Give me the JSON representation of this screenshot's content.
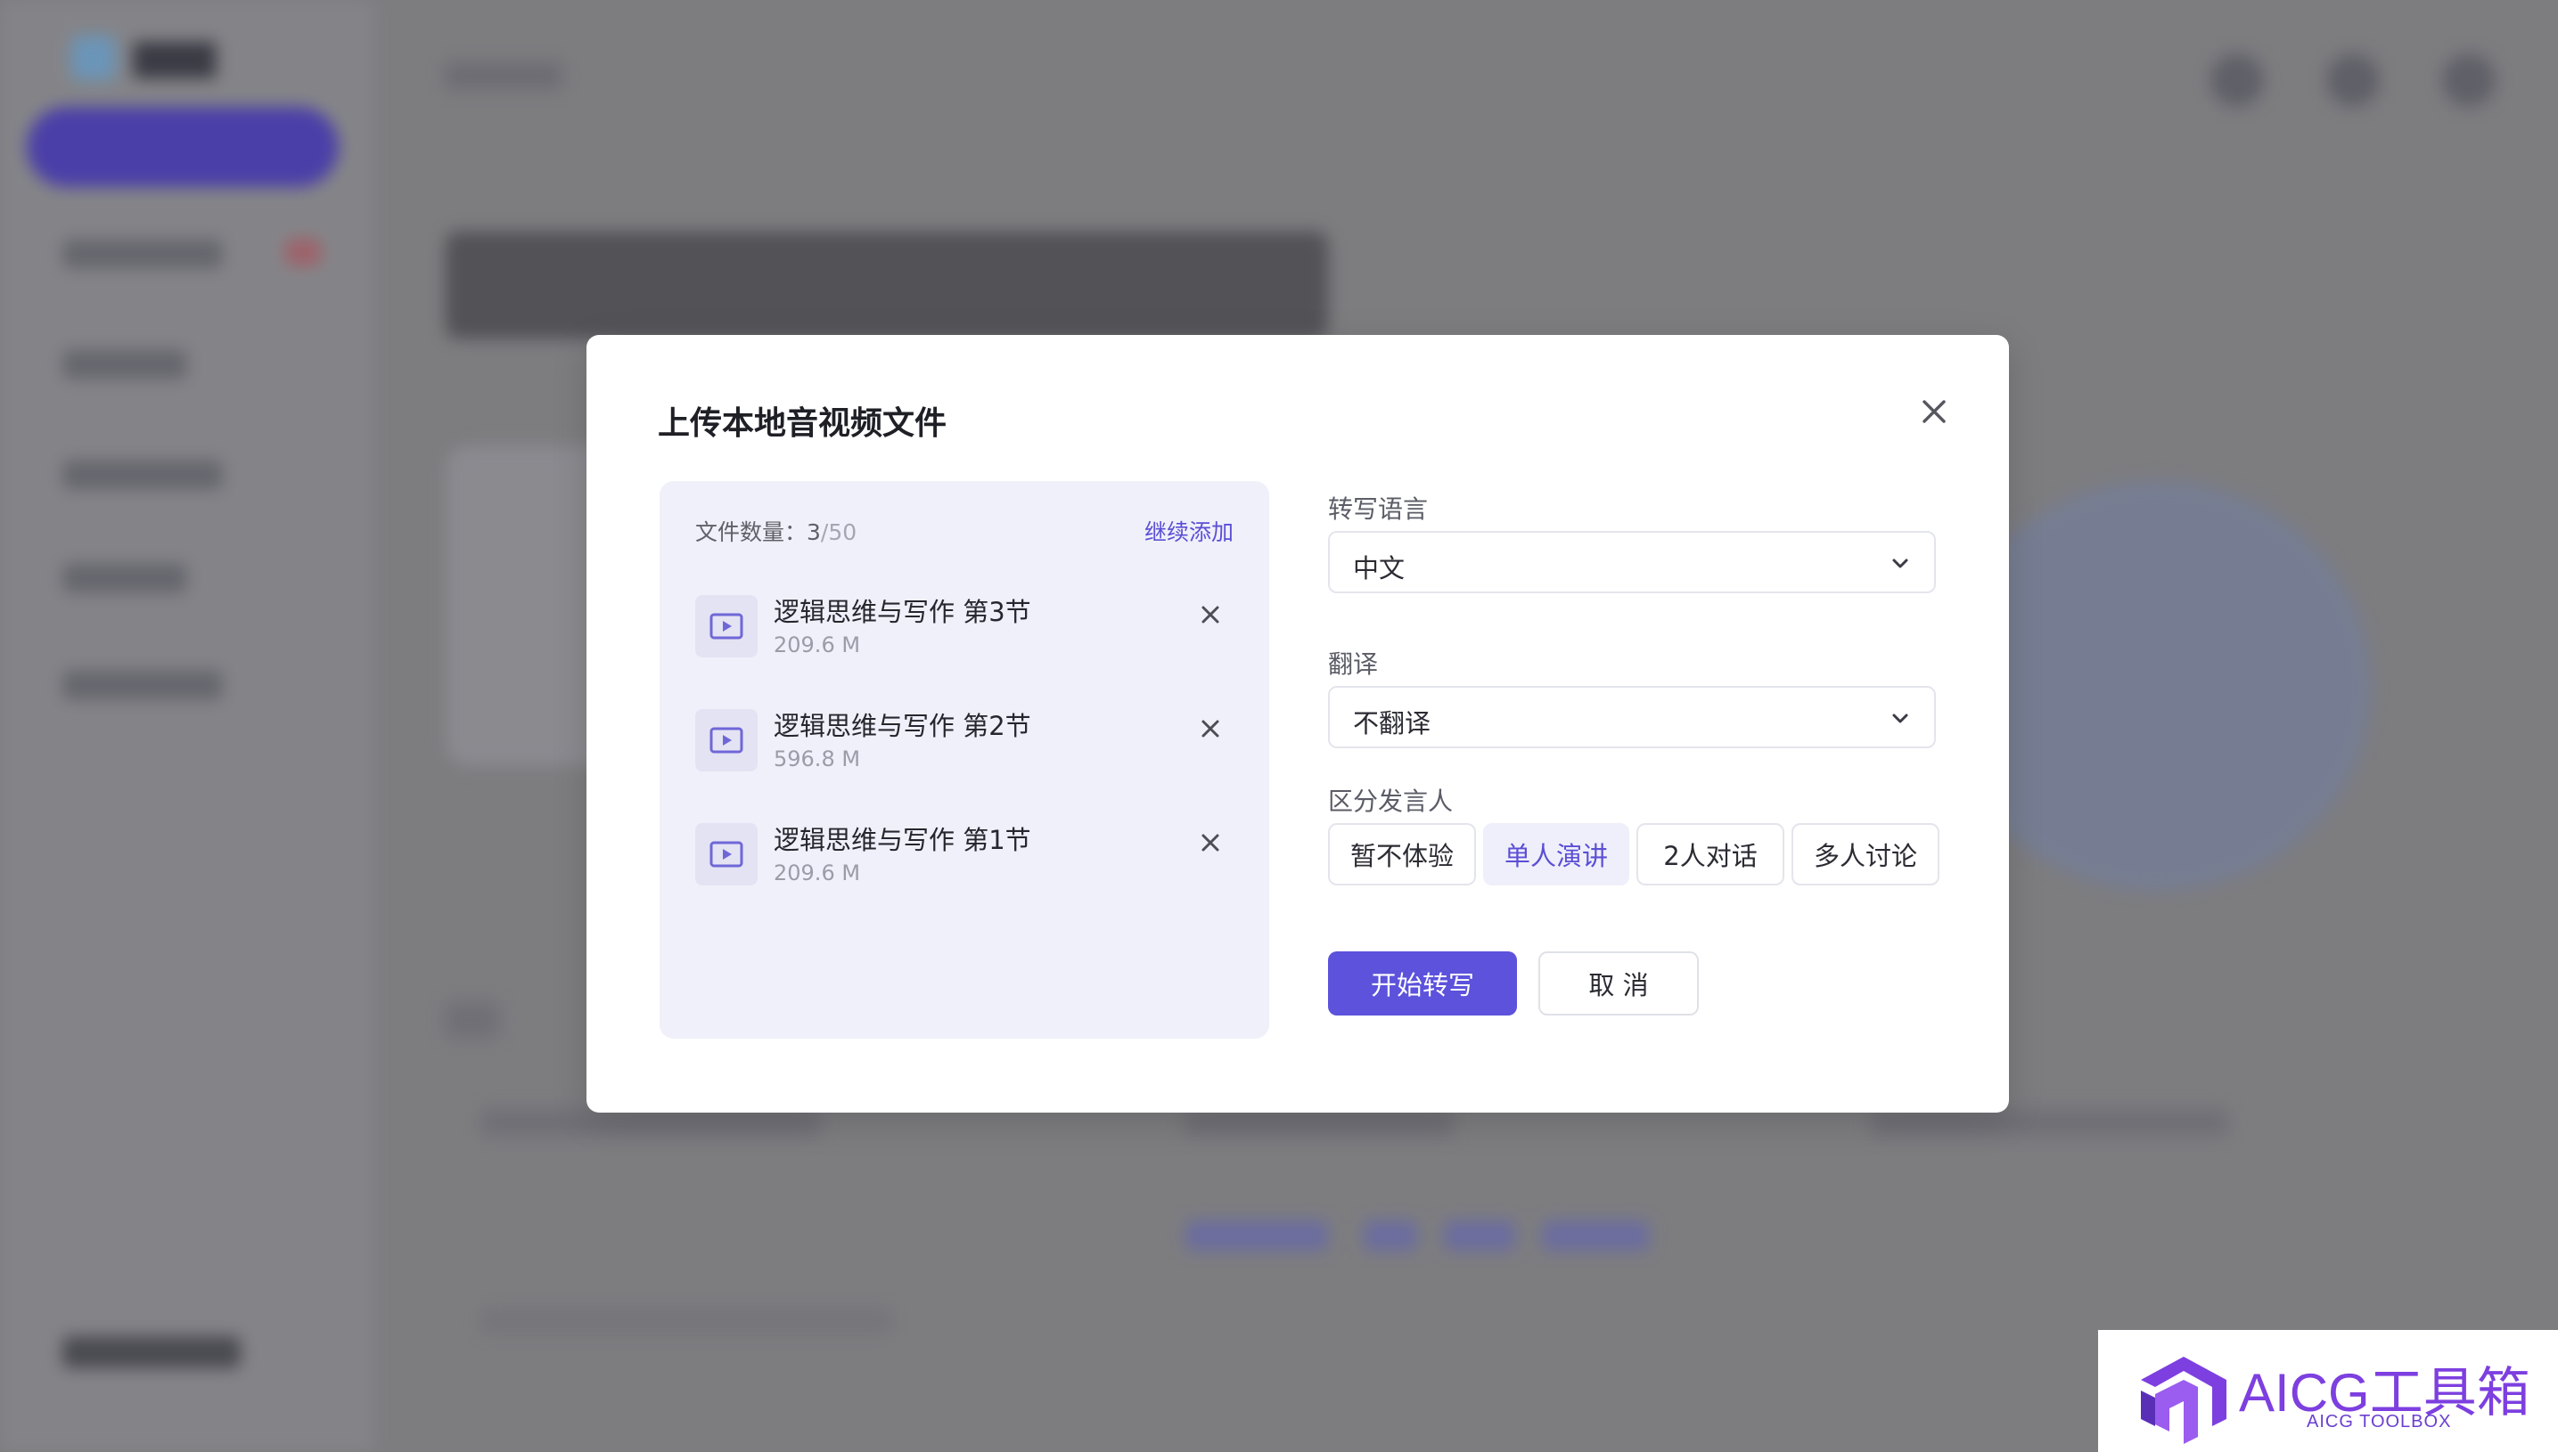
{
  "modal": {
    "title": "上传本地音视频文件",
    "file_panel": {
      "count_label": "文件数量：",
      "count_current": "3",
      "count_total": "/50",
      "add_more": "继续添加",
      "files": [
        {
          "name": "逻辑思维与写作 第3节",
          "size": "209.6 M"
        },
        {
          "name": "逻辑思维与写作 第2节",
          "size": "596.8 M"
        },
        {
          "name": "逻辑思维与写作 第1节",
          "size": "209.6 M"
        }
      ]
    },
    "form": {
      "language_label": "转写语言",
      "language_value": "中文",
      "translate_label": "翻译",
      "translate_value": "不翻译",
      "speaker_label": "区分发言人",
      "speaker_options": [
        "暂不体验",
        "单人演讲",
        "2人对话",
        "多人讨论"
      ],
      "speaker_selected": "单人演讲",
      "start_button": "开始转写",
      "cancel_button": "取 消"
    }
  },
  "watermark": {
    "text": "AICG工具箱",
    "subtext": "AICG TOOLBOX"
  },
  "colors": {
    "accent": "#5c52dc",
    "overlay": "#7d7d80",
    "panel_bg": "#f0f0fa"
  }
}
